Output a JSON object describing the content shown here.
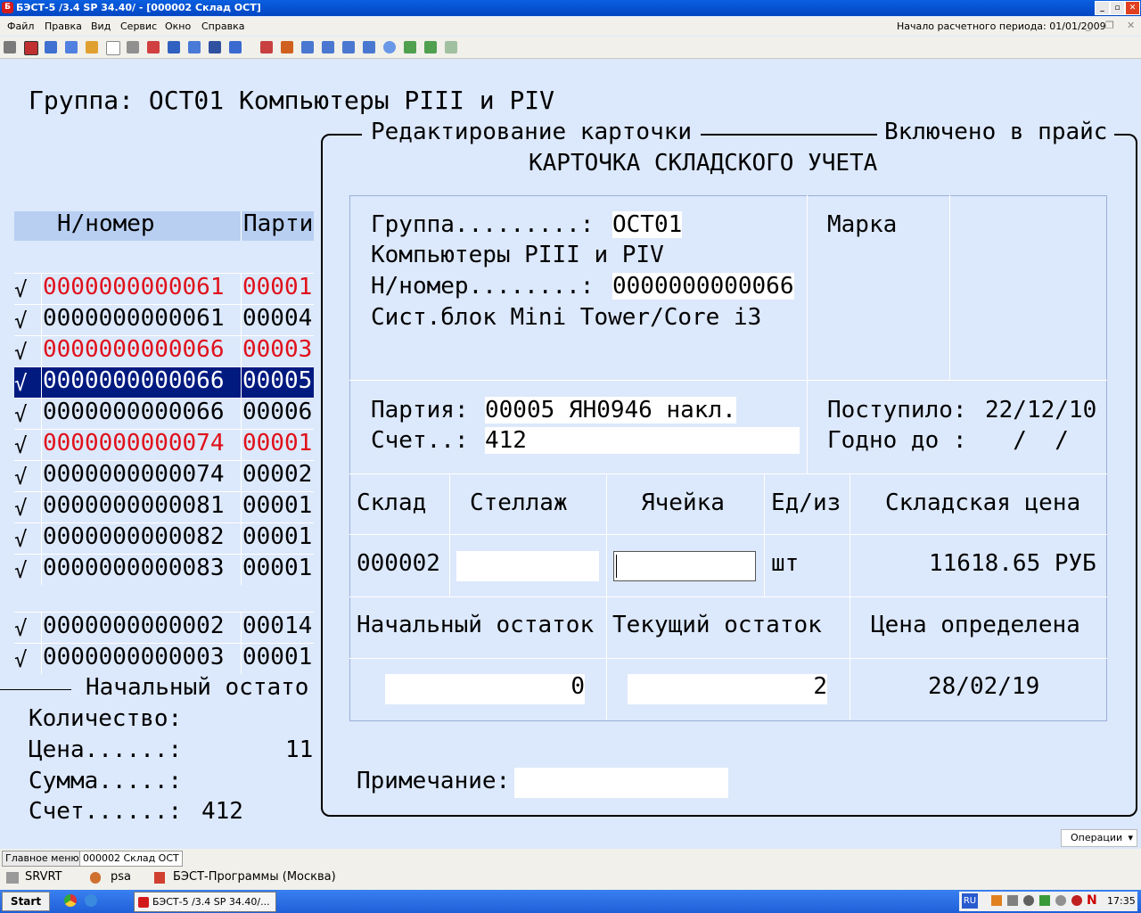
{
  "window": {
    "title": "БЭСТ-5 /3.4 SP 34.40/ - [000002  Склад ОСТ]",
    "app_icon": "Б",
    "min": "_",
    "max": "▫",
    "close": "✕"
  },
  "menu": {
    "items": [
      "Файл",
      "Правка",
      "Вид",
      "Сервис",
      "Окно",
      "Справка"
    ],
    "period": "Начало расчетного периода: 01/01/2009"
  },
  "header": {
    "group_line": "Группа: ОСТ01 Компьютеры PIII и PIV"
  },
  "list": {
    "col_number": "Н/номер",
    "col_party": "Парти",
    "rows": [
      {
        "check": "√",
        "number": "0000000000061",
        "party": "00001",
        "style": "red"
      },
      {
        "check": "√",
        "number": "0000000000061",
        "party": "00004",
        "style": "normal"
      },
      {
        "check": "√",
        "number": "0000000000066",
        "party": "00003",
        "style": "red"
      },
      {
        "check": "√",
        "number": "0000000000066",
        "party": "00005",
        "style": "selected"
      },
      {
        "check": "√",
        "number": "0000000000066",
        "party": "00006",
        "style": "normal"
      },
      {
        "check": "√",
        "number": "0000000000074",
        "party": "00001",
        "style": "red"
      },
      {
        "check": "√",
        "number": "0000000000074",
        "party": "00002",
        "style": "normal"
      },
      {
        "check": "√",
        "number": "0000000000081",
        "party": "00001",
        "style": "normal"
      },
      {
        "check": "√",
        "number": "0000000000082",
        "party": "00001",
        "style": "normal"
      },
      {
        "check": "√",
        "number": "0000000000083",
        "party": "00001",
        "style": "normal"
      }
    ],
    "rows2": [
      {
        "check": "√",
        "number": "0000000000002",
        "party": "00014"
      },
      {
        "check": "√",
        "number": "0000000000003",
        "party": "00001"
      }
    ]
  },
  "summary": {
    "title": "Начальный остато",
    "qty_label": "Количество:",
    "price_label": "Цена......:",
    "price_value": "11",
    "sum_label": "Сумма.....:",
    "acc_label": "Счет......:",
    "acc_value": "412"
  },
  "card": {
    "frame_title": "Редактирование карточки",
    "frame_right": "Включено в прайс",
    "heading": "КАРТОЧКА СКЛАДСКОГО УЧЕТА",
    "group_label": "Группа.........:",
    "group_value": "ОСТ01",
    "group_name": "Компьютеры PIII и PIV",
    "number_label": "Н/номер........:",
    "number_value": "0000000000066",
    "item_name": "Сист.блок Mini Tower/Core i3",
    "brand_label": "Марка",
    "party_label": "Партия:",
    "party_value": "00005 ЯН0946 накл.",
    "acc_label": "Счет..:",
    "acc_value": "412",
    "received_label": "Поступило:",
    "received_value": "22/12/10",
    "valid_label": "Годно до :",
    "valid_value": "  /  /",
    "col_sklad": "Склад",
    "col_stellazh": "Стеллаж",
    "col_cell": "Ячейка",
    "col_unit": "Ед/из",
    "col_price": "Складская цена",
    "sklad_value": "000002",
    "unit_value": "шт",
    "price_value": "11618.65 РУБ",
    "start_bal_label": "Начальный остаток",
    "cur_bal_label": "Текущий остаток",
    "price_date_label": "Цена определена",
    "start_bal_value": "0",
    "cur_bal_value": "2",
    "price_date_value": "28/02/19",
    "note_label": "Примечание:"
  },
  "bottom": {
    "tabs": [
      "Главное меню",
      "000002  Склад ОСТ"
    ],
    "operations": "Операции",
    "quicklaunch": [
      "SRVRT",
      "psa",
      "БЭСТ-Программы (Москва)"
    ]
  },
  "taskbar": {
    "start": "Start",
    "task": "БЭСТ-5 /3.4 SP 34.40/...",
    "lang": "RU",
    "time": "17:35"
  }
}
